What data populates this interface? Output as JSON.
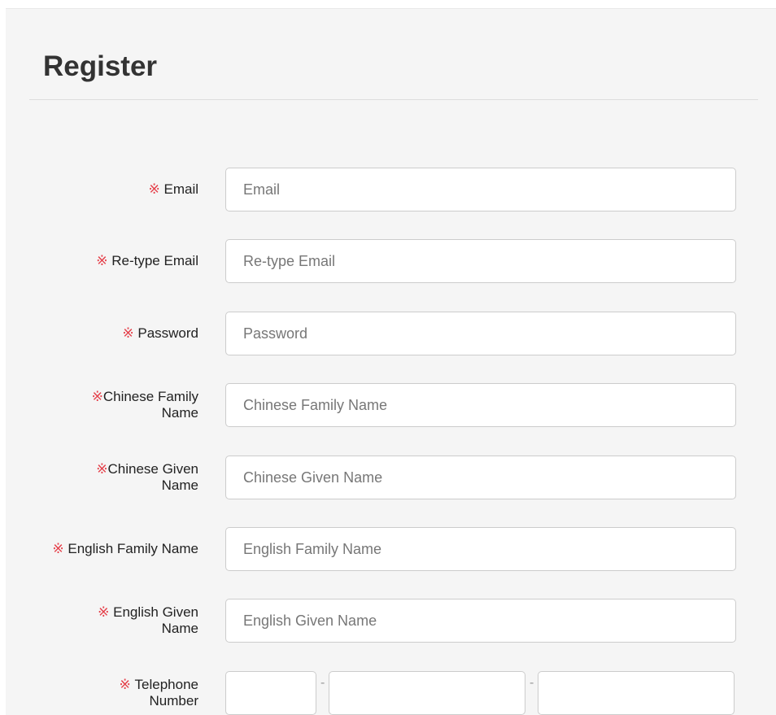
{
  "page": {
    "title": "Register",
    "required_mark": "※"
  },
  "form": {
    "fields": [
      {
        "label": "Email",
        "placeholder": "Email"
      },
      {
        "label": "Re-type Email",
        "placeholder": "Re-type Email"
      },
      {
        "label": "Password",
        "placeholder": "Password"
      },
      {
        "label": "Chinese Family Name",
        "placeholder": "Chinese Family Name"
      },
      {
        "label": "Chinese Given Name",
        "placeholder": "Chinese Given Name"
      },
      {
        "label": "English Family Name",
        "placeholder": "English Family Name"
      },
      {
        "label": "English Given Name",
        "placeholder": "English Given Name"
      }
    ],
    "telephone": {
      "label": "Telephone Number",
      "separator": "-"
    }
  },
  "colors": {
    "required_mark": "#e5404a",
    "panel_background": "#f5f5f5",
    "input_border": "#cccccc"
  }
}
